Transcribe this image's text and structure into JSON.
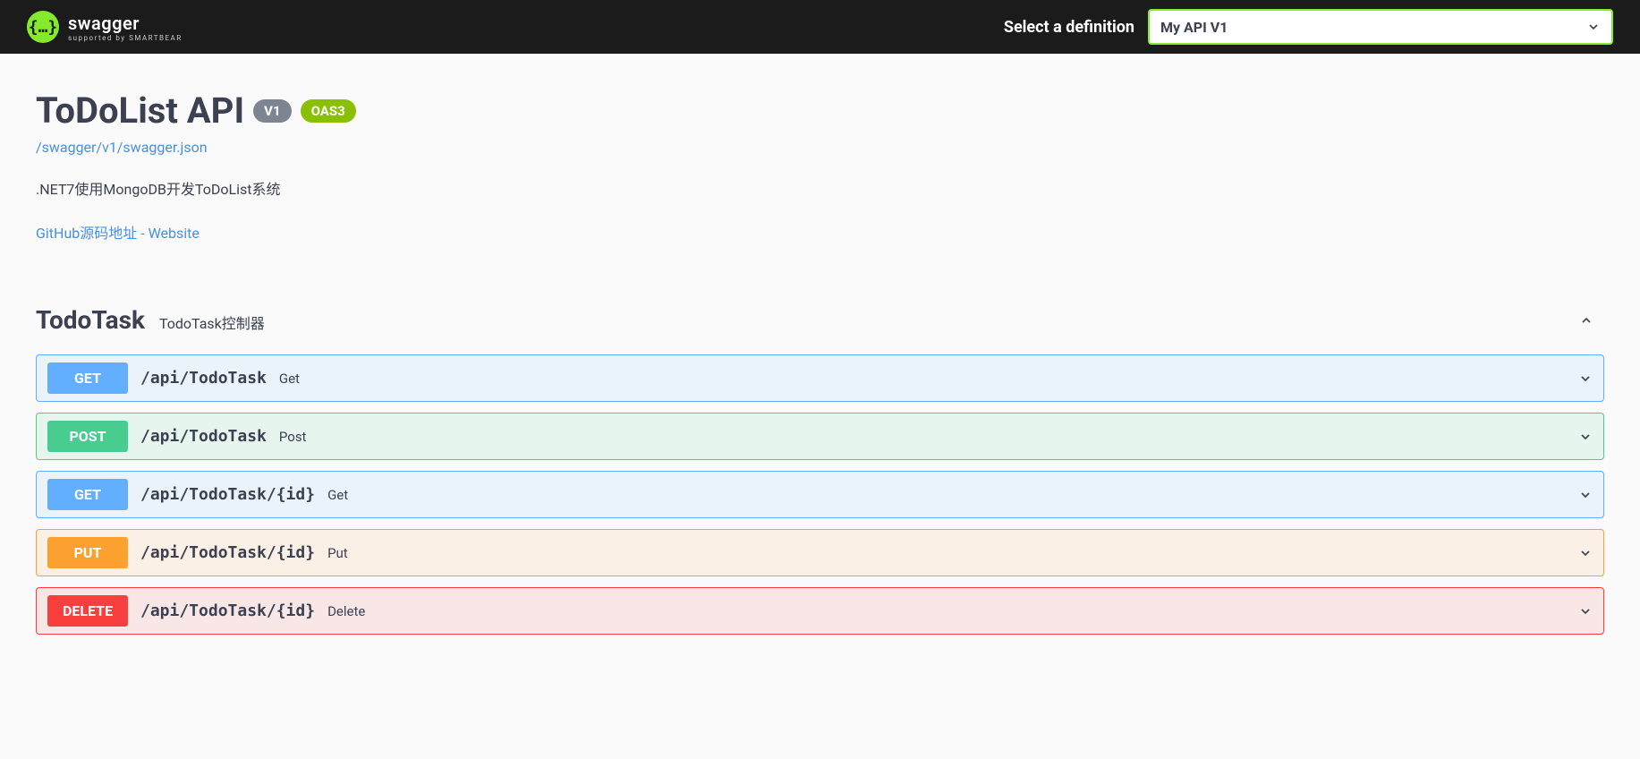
{
  "topbar": {
    "logo_text": "swagger",
    "logo_sub": "supported by SMARTBEAR",
    "definition_label": "Select a definition",
    "definition_value": "My API V1"
  },
  "info": {
    "title": "ToDoList API",
    "version_badge": "V1",
    "oas_badge": "OAS3",
    "spec_url": "/swagger/v1/swagger.json",
    "description": ".NET7使用MongoDB开发ToDoList系统",
    "contact_text": "GitHub源码地址 - Website"
  },
  "tag": {
    "name": "TodoTask",
    "desc": "TodoTask控制器"
  },
  "operations": [
    {
      "method": "GET",
      "css": "op-get",
      "path": "/api/TodoTask",
      "summary": "Get"
    },
    {
      "method": "POST",
      "css": "op-post",
      "path": "/api/TodoTask",
      "summary": "Post"
    },
    {
      "method": "GET",
      "css": "op-get",
      "path": "/api/TodoTask/{id}",
      "summary": "Get"
    },
    {
      "method": "PUT",
      "css": "op-put",
      "path": "/api/TodoTask/{id}",
      "summary": "Put"
    },
    {
      "method": "DELETE",
      "css": "op-delete",
      "path": "/api/TodoTask/{id}",
      "summary": "Delete"
    }
  ]
}
